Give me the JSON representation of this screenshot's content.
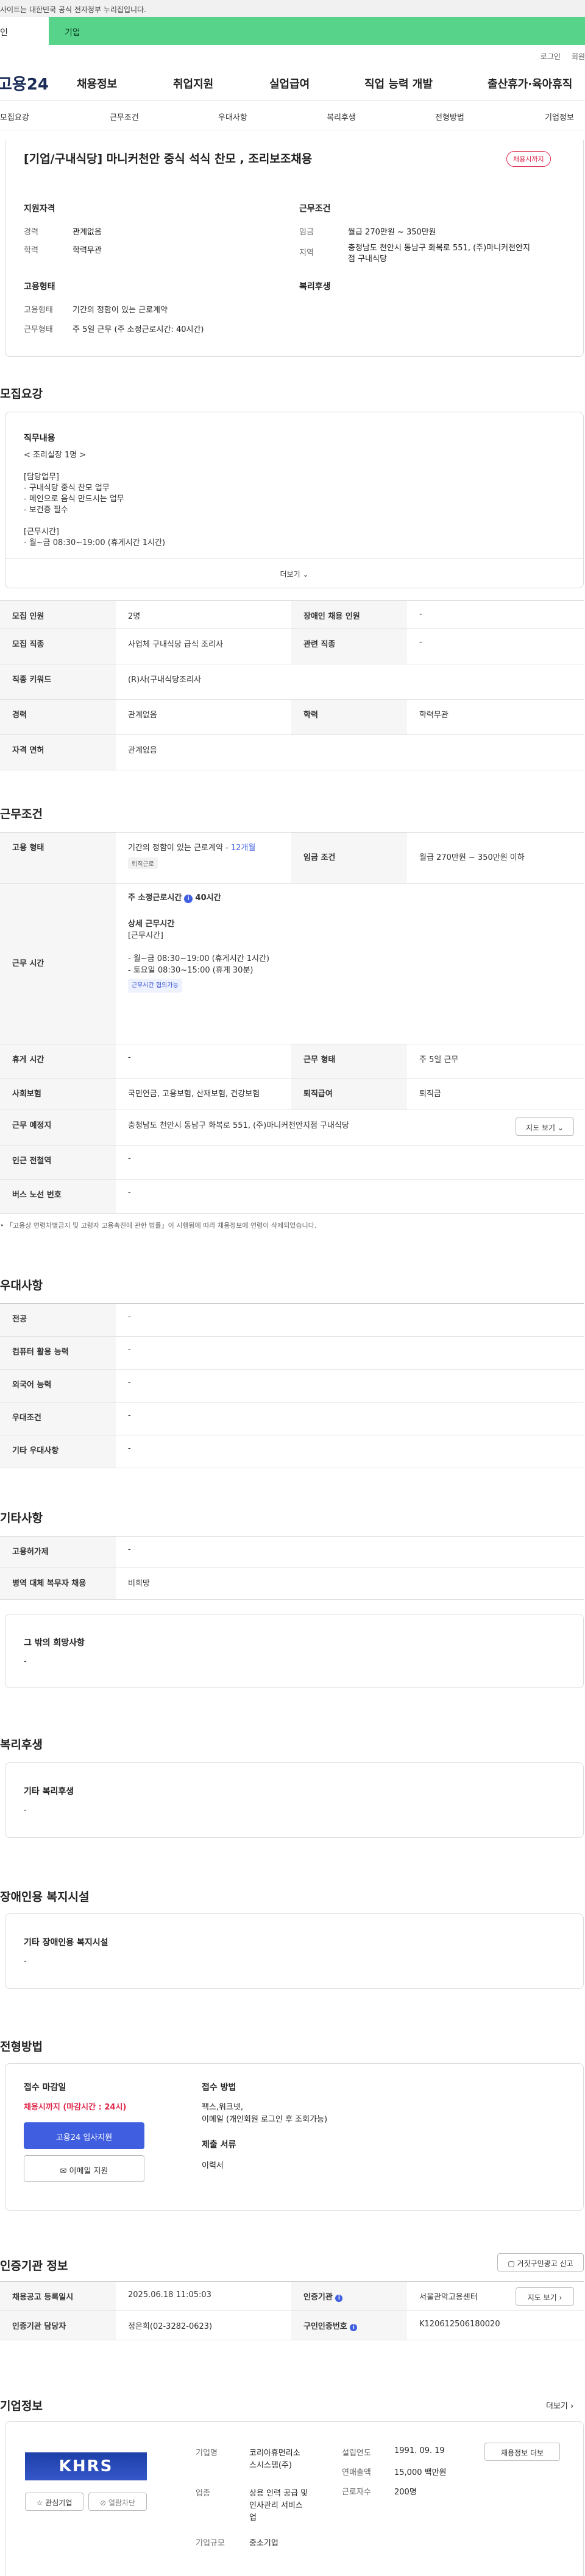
{
  "topbar": {
    "notice": "사이트는 대한민국 공식 전자정부 누리집입니다."
  },
  "tabs": {
    "individual": "인",
    "company": "기업"
  },
  "util": {
    "login": "로그인",
    "join": "회원"
  },
  "gnb": {
    "logo": "고용24",
    "menus": [
      "채용정보",
      "취업지원",
      "실업급여",
      "직업 능력 개발",
      "출산휴가·육아휴직"
    ]
  },
  "snb": [
    "모집요강",
    "근무조건",
    "우대사항",
    "복리후생",
    "전형방법",
    "기업정보"
  ],
  "job": {
    "title": "[기업/구내식당] 마니커천안 중식 석식 찬모 , 조리보조채용",
    "badge": "채용시까지",
    "qual_head": "지원자격",
    "career_l": "경력",
    "career_v": "관계없음",
    "edu_l": "학력",
    "edu_v": "학력무관",
    "cond_head": "근무조건",
    "wage_l": "임금",
    "wage_v": "월급 270만원 ~ 350만원",
    "area_l": "지역",
    "area_v1": "충청남도 천안시 동남구 화복로 551, (주)마니커천안지",
    "area_v2": "점 구내식당",
    "emp_head": "고용형태",
    "emptype_l": "고용형태",
    "emptype_v": "기간의 정함이 있는 근로계약",
    "worktype_l": "근무형태",
    "worktype_v": "주 5일 근무 (주 소정근로시간: 40시간)",
    "welfare_head": "복리후생"
  },
  "recruit": {
    "heading": "모집요강",
    "duty_head": "직무내용",
    "lines": [
      "< 조리실장 1명 >",
      "",
      "[담당업무]",
      "- 구내식당 중식 찬모 업무",
      "- 메인으로 음식 만드시는 업무",
      "- 보건증 필수",
      "",
      "[근무시간]",
      "- 월~금 08:30~19:00 (휴게시간 1시간)"
    ],
    "more": "더보기",
    "rows": [
      {
        "l1": "모집 인원",
        "v1": "2명",
        "l2": "장애인 채용 인원",
        "v2": "-"
      },
      {
        "l1": "모집 직종",
        "v1": "사업체 구내식당 급식 조리사",
        "l2": "관련 직종",
        "v2": "-"
      }
    ],
    "keyword_l": "직종 키워드",
    "keyword_v": "(R)사(구내식당조리사",
    "career_l": "경력",
    "career_v": "관계없음",
    "edu_l": "학력",
    "edu_v": "학력무관",
    "license_l": "자격 면허",
    "license_v": "관계없음"
  },
  "work": {
    "heading": "근무조건",
    "emp_l": "고용 형태",
    "emp_v": "기간의 정함이 있는 근로계약 -",
    "emp_link": "12개월",
    "emp_tag": "퇴직근로",
    "wage_l": "임금 조건",
    "wage_v": "월급 270만원 ~ 350만원 이하",
    "time_l": "근무 시간",
    "time_total": "주 소정근로시간",
    "time_total_v": "40시간",
    "time_detail_head": "상세 근무시간",
    "time_lines": [
      "[근무시간]",
      "",
      "- 월~금 08:30~19:00 (휴게시간 1시간)",
      "- 토요일 08:30~15:00 (휴게 30분)"
    ],
    "time_tag": "근무시간 협의가능",
    "rest_l": "휴게 시간",
    "rest_v": "-",
    "form_l": "근무 형태",
    "form_v": "주 5일 근무",
    "ins_l": "사회보험",
    "ins_v": "국민연금, 고용보험, 산재보험, 건강보험",
    "ret_l": "퇴직급여",
    "ret_v": "퇴직금",
    "place_l": "근무 예정지",
    "place_v": "충청남도 천안시 동남구 화복로 551, (주)마니커천안지점 구내식당",
    "map_btn": "지도 보기",
    "metro_l": "인근 전철역",
    "metro_v": "-",
    "bus_l": "버스 노선 번호",
    "bus_v": "-",
    "note": "「고용상 연령차별금지 및 고령자 고용촉진에 관한 법률」이 시행됨에 따라 채용정보에 연령이 삭제되었습니다."
  },
  "pref": {
    "heading": "우대사항",
    "rows": [
      [
        "전공",
        "-"
      ],
      [
        "컴퓨터 활용 능력",
        "-"
      ],
      [
        "외국어 능력",
        "-"
      ],
      [
        "우대조건",
        "-"
      ],
      [
        "기타 우대사항",
        "-"
      ]
    ]
  },
  "etc": {
    "heading": "기타사항",
    "rows": [
      [
        "고용허가제",
        "-"
      ],
      [
        "병역 대체 복무자 채용",
        "비희망"
      ]
    ],
    "other_head": "그 밖의 희망사항",
    "other_v": "-"
  },
  "welfare": {
    "heading": "복리후생",
    "sub": "기타 복리후생",
    "v": "-"
  },
  "disabled": {
    "heading": "장애인용 복지시설",
    "sub": "기타 장애인용 복지시설",
    "v": "-"
  },
  "process": {
    "heading": "전형방법",
    "deadline_head": "접수 마감일",
    "deadline_v": "채용시까지 (마감시간 : 24시)",
    "apply_btn": "고용24 입사지원",
    "email_btn": "이메일 지원",
    "method_head": "접수 방법",
    "method_lines": [
      "팩스,워크넷,",
      "이메일 (개인회원 로그인 후 조회가능)"
    ],
    "docs_head": "제출 서류",
    "docs_v": "이력서"
  },
  "agency": {
    "heading": "인증기관 정보",
    "report_btn": "거짓구인광고 신고",
    "reg_l": "채용공고 등록일시",
    "reg_v": "2025.06.18 11:05:03",
    "org_l": "인증기관",
    "org_v": "서울관악고용센터",
    "map_btn": "지도 보기",
    "mgr_l": "인증기관 담당자",
    "mgr_v": "정은희(02-3282-0623)",
    "no_l": "구인인증번호",
    "no_v": "K120612506180020"
  },
  "company": {
    "heading": "기업정보",
    "more": "더보기",
    "logo_text": "KHRS",
    "fav_btn": "관심기업",
    "block_btn": "열람차단",
    "name_l": "기업명",
    "name_v": [
      "코리아휴먼리소",
      "스시스템(주)"
    ],
    "ind_l": "업종",
    "ind_v": [
      "상용 인력 공급 및",
      "인사관리 서비스",
      "업"
    ],
    "size_l": "기업규모",
    "size_v": "중소기업",
    "est_l": "설립연도",
    "est_v": "1991. 09. 19",
    "sales_l": "연매출액",
    "sales_v": "15,000 백만원",
    "emp_l": "근로자수",
    "emp_v": "200명",
    "jobs_btn": "채용정보 더보"
  },
  "colors": {
    "green": "#58d38a",
    "blue": "#3f5fe0",
    "red": "#e0264a",
    "navy": "#1a2c57"
  }
}
